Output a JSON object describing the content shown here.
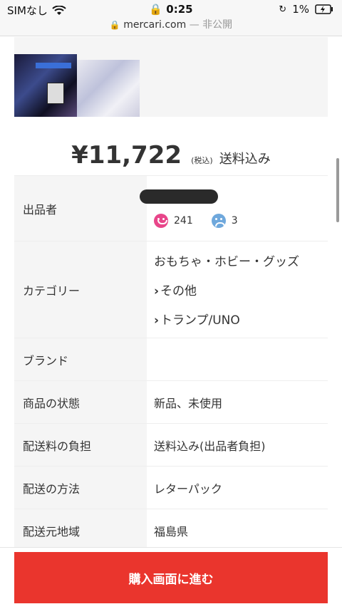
{
  "status_bar": {
    "carrier": "SIMなし",
    "time": "0:25",
    "battery": "1%",
    "icons": [
      "wifi-icon",
      "lock-icon",
      "rotation-lock-icon",
      "battery-icon"
    ]
  },
  "url_bar": {
    "domain": "mercari.com",
    "suffix": "— 非公開"
  },
  "price": {
    "amount": "¥11,722",
    "tax_note": "(税込)",
    "shipping": "送料込み"
  },
  "details": {
    "seller": {
      "label": "出品者",
      "good_count": "241",
      "bad_count": "3"
    },
    "category": {
      "label": "カテゴリー",
      "items": [
        "おもちゃ・ホビー・グッズ",
        "その他",
        "トランプ/UNO"
      ]
    },
    "brand": {
      "label": "ブランド",
      "value": ""
    },
    "condition": {
      "label": "商品の状態",
      "value": "新品、未使用"
    },
    "shipping_fee": {
      "label": "配送料の負担",
      "value": "送料込み(出品者負担)"
    },
    "shipping_method": {
      "label": "配送の方法",
      "value": "レターパック"
    },
    "ship_from": {
      "label": "配送元地域",
      "value": "福島県"
    }
  },
  "buy_button": {
    "label": "購入画面に進む"
  },
  "colors": {
    "accent_red": "#ea352d",
    "link_blue": "#0099e8",
    "good_pink": "#e8468a",
    "bad_blue": "#6fa8dc"
  }
}
